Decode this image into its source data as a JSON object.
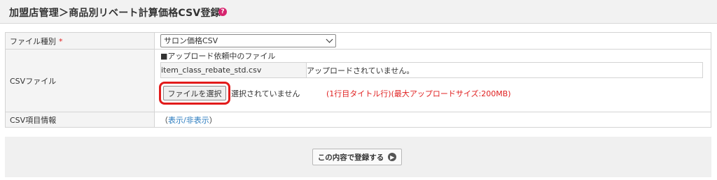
{
  "header": {
    "title": "加盟店管理＞商品別リベート計算価格CSV登録",
    "help_icon": "?"
  },
  "form": {
    "file_type": {
      "label": "ファイル種別",
      "required_mark": "*",
      "selected": "サロン価格CSV"
    },
    "csv_file": {
      "label": "CSVファイル",
      "pending_heading": "■アップロード依頼中のファイル",
      "pending_file_name": "item_class_rebate_std.csv",
      "pending_status": "アップロードされていません。",
      "choose_button": "ファイルを選択",
      "no_file_text": "選択されていません",
      "note": "(1行目タイトル行)(最大アップロードサイズ:200MB)"
    },
    "csv_item_info": {
      "label": "CSV項目情報",
      "open_paren": "（",
      "toggle_link": "表示/非表示",
      "close_paren": "）"
    }
  },
  "footer": {
    "submit_label": "この内容で登録する",
    "submit_icon": "arrow-right-circle-icon"
  },
  "colors": {
    "required": "#e02020",
    "highlight": "#e21b1b",
    "link": "#2a7bbf",
    "help_icon": "#d6246e"
  }
}
